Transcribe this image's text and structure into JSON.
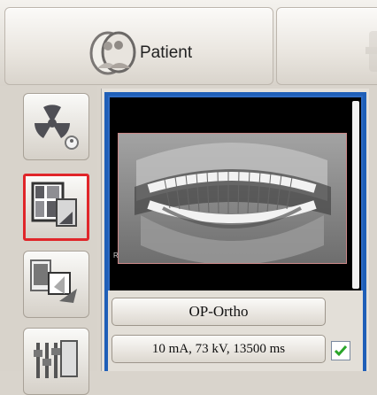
{
  "header": {
    "patient_tab_label": "Patient"
  },
  "sidebar": {
    "items": [
      {
        "name": "radiation",
        "icon": "radiation-icon"
      },
      {
        "name": "layout",
        "icon": "layout-grid-icon",
        "selected": true
      },
      {
        "name": "move",
        "icon": "image-transfer-icon"
      },
      {
        "name": "settings",
        "icon": "sliders-icon"
      }
    ]
  },
  "program": {
    "mode_label": "OP-Ortho",
    "params_label": "10 mA, 73 kV, 13500 ms",
    "enabled": true,
    "side_marker": "R"
  },
  "colors": {
    "selected_border": "#e0262a",
    "panel_border": "#1f5fb8"
  }
}
